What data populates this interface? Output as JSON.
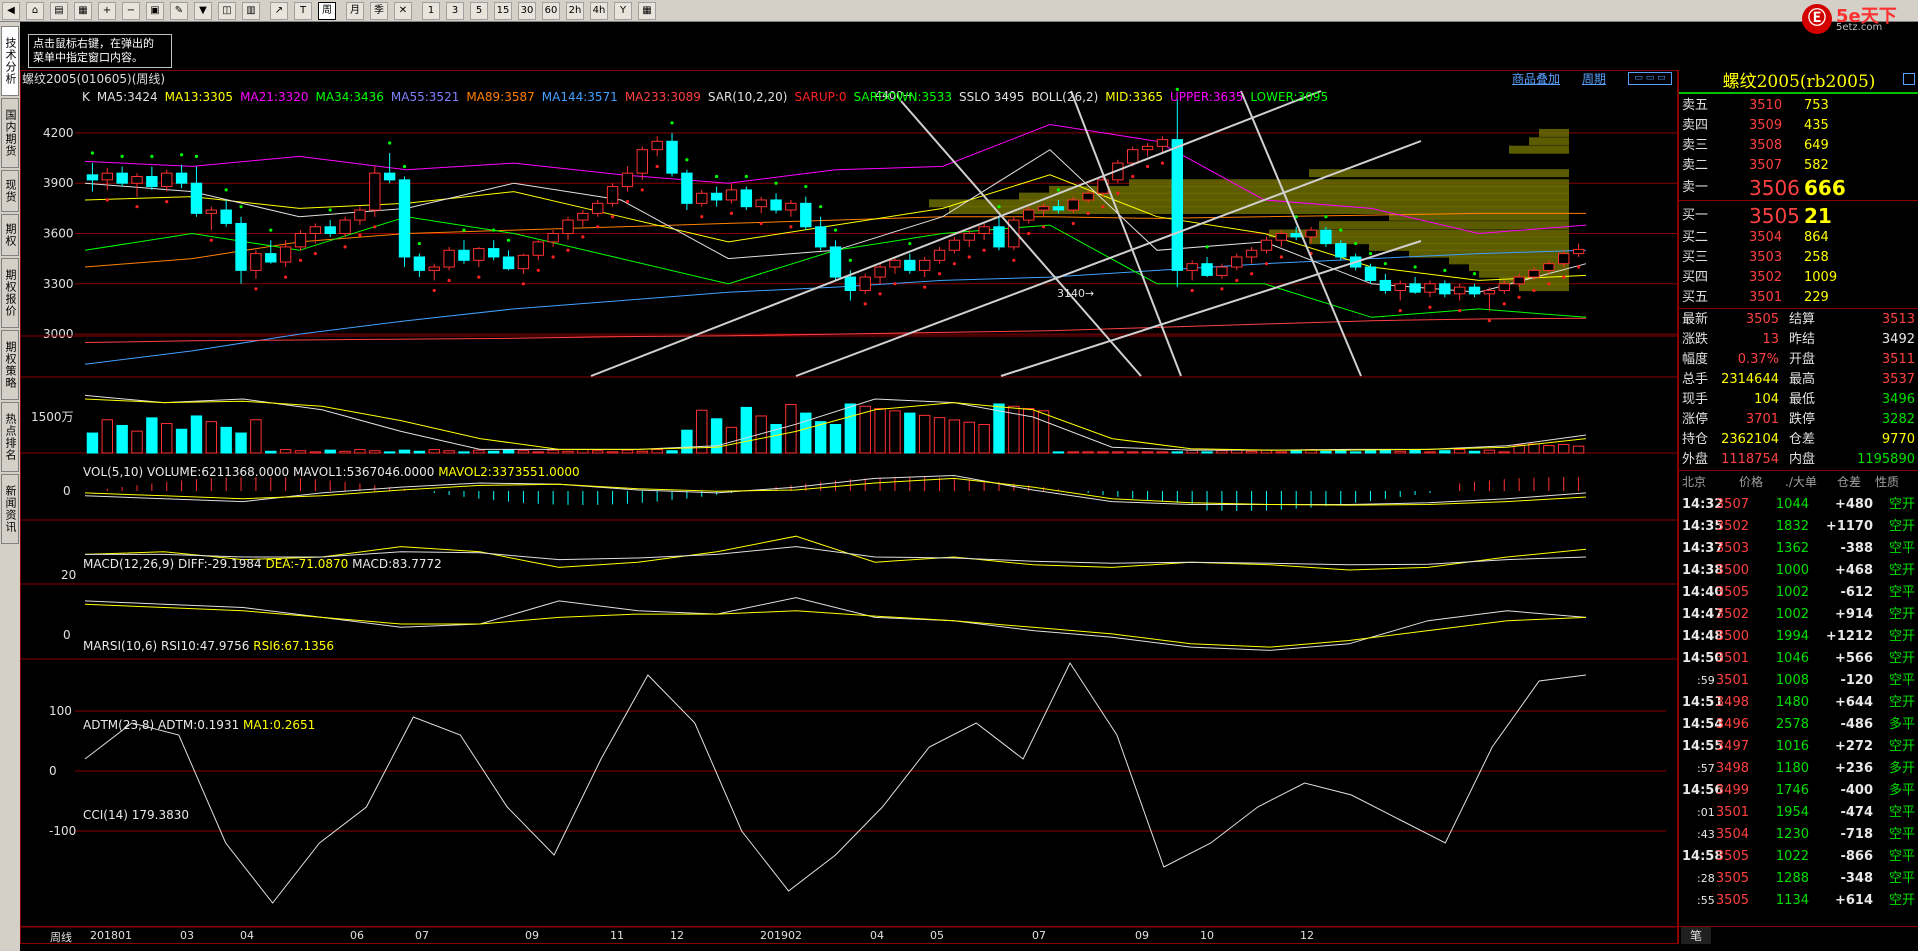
{
  "toolbar": {
    "buttons": [
      "back",
      "home",
      "folder",
      "doc",
      "zoom-in",
      "zoom-out",
      "window",
      "pen",
      "filter",
      "custom",
      "table",
      "trend",
      "tick",
      "weekly",
      "monthly",
      "season",
      "cross",
      "1",
      "3",
      "5",
      "15",
      "30",
      "60",
      "2h",
      "4h",
      "Y",
      "calc"
    ],
    "weekly_label": "周",
    "monthly_label": "月",
    "season_label": "季"
  },
  "logo": {
    "text": "5e天下",
    "sub": "5etz.com"
  },
  "hint": {
    "line1": "点击鼠标右键，在弹出的",
    "line2": "菜单中指定窗口内容。"
  },
  "left_tabs": [
    "技术分析",
    "国内期货",
    "现货",
    "期权",
    "期权报价",
    "期权策略",
    "热点排名",
    "新闻资讯"
  ],
  "title": {
    "left": "螺纹2005(010605)(周线)",
    "link1": "商品叠加",
    "link2": "周期"
  },
  "main_indicators": [
    {
      "t": "K",
      "c": "#e0e0e0"
    },
    {
      "t": "MA5:3424",
      "c": "#e0e0e0"
    },
    {
      "t": "MA13:3305",
      "c": "#ffff00"
    },
    {
      "t": "MA21:3320",
      "c": "#ff00ff"
    },
    {
      "t": "MA34:3436",
      "c": "#00ff00"
    },
    {
      "t": "MA55:3521",
      "c": "#8080ff"
    },
    {
      "t": "MA89:3587",
      "c": "#ff8000"
    },
    {
      "t": "MA144:3571",
      "c": "#40a0ff"
    },
    {
      "t": "MA233:3089",
      "c": "#ff4040"
    },
    {
      "t": "SAR(10,2,20)",
      "c": "#e0e0e0"
    },
    {
      "t": "SARUP:0",
      "c": "#ff2020"
    },
    {
      "t": "SARDOWN:3533",
      "c": "#00ff00"
    },
    {
      "t": "SSLO 3495",
      "c": "#e0e0e0"
    },
    {
      "t": "BOLL(26,2)",
      "c": "#e0e0e0"
    },
    {
      "t": "MID:3365",
      "c": "#ffff00"
    },
    {
      "t": "UPPER:3635",
      "c": "#ff00ff"
    },
    {
      "t": "LOWER:3095",
      "c": "#00ff00"
    }
  ],
  "price_axis": [
    "4200",
    "3900",
    "3600",
    "3300",
    "3000"
  ],
  "annot_high": "4400",
  "annot_low": "3140",
  "vol_label": {
    "a": "VOL(5,10)",
    "b": "VOLUME:6211368.0000",
    "c": "MAVOL1:5367046.0000",
    "d": "MAVOL2:3373551.0000"
  },
  "vol_axis": "1500万",
  "macd_label": {
    "a": "MACD(12,26,9)",
    "b": "DIFF:-29.1984",
    "c": "DEA:-71.0870",
    "d": "MACD:83.7772"
  },
  "macd_axis": "0",
  "marsi_label": {
    "a": "MARSI(10,6)",
    "b": "RSI10:47.9756",
    "c": "RSI6:67.1356"
  },
  "marsi_axis": "20",
  "adtm_label": {
    "a": "ADTM(23,8)",
    "b": "ADTM:0.1931",
    "c": "MA1:0.2651"
  },
  "adtm_axis": "0",
  "cci_label": {
    "a": "CCI(14)",
    "b": "179.3830"
  },
  "cci_axis": [
    "100",
    "0",
    "-100"
  ],
  "x_axis": [
    "201801",
    "03",
    "04",
    "06",
    "07",
    "09",
    "11",
    "12",
    "201902",
    "04",
    "05",
    "07",
    "09",
    "10",
    "12"
  ],
  "period_label": "周线",
  "quote": {
    "name": "螺纹2005(rb2005)",
    "asks": [
      {
        "l": "卖五",
        "p": "3510",
        "v": "753"
      },
      {
        "l": "卖四",
        "p": "3509",
        "v": "435"
      },
      {
        "l": "卖三",
        "p": "3508",
        "v": "649"
      },
      {
        "l": "卖二",
        "p": "3507",
        "v": "582"
      },
      {
        "l": "卖一",
        "p": "3506",
        "v": "666"
      }
    ],
    "bids": [
      {
        "l": "买一",
        "p": "3505",
        "v": "21"
      },
      {
        "l": "买二",
        "p": "3504",
        "v": "864"
      },
      {
        "l": "买三",
        "p": "3503",
        "v": "258"
      },
      {
        "l": "买四",
        "p": "3502",
        "v": "1009"
      },
      {
        "l": "买五",
        "p": "3501",
        "v": "229"
      }
    ],
    "stats": [
      {
        "l1": "最新",
        "v1": "3505",
        "l2": "结算",
        "v2": "3513"
      },
      {
        "l1": "涨跌",
        "v1": "13",
        "l2": "昨结",
        "v2": "3492"
      },
      {
        "l1": "幅度",
        "v1": "0.37%",
        "l2": "开盘",
        "v2": "3511"
      },
      {
        "l1": "总手",
        "v1": "2314644",
        "l2": "最高",
        "v2": "3537"
      },
      {
        "l1": "现手",
        "v1": "104",
        "l2": "最低",
        "v2": "3496"
      },
      {
        "l1": "涨停",
        "v1": "3701",
        "l2": "跌停",
        "v2": "3282"
      },
      {
        "l1": "持仓",
        "v1": "2362104",
        "l2": "仓差",
        "v2": "9770"
      },
      {
        "l1": "外盘",
        "v1": "1118754",
        "l2": "内盘",
        "v2": "1195890"
      }
    ],
    "tick_headers": [
      "北京",
      "价格",
      "./大单",
      "仓差",
      "性质"
    ],
    "ticks": [
      {
        "t": "14:32",
        "p": "3507",
        "v": "1044",
        "d": "+480",
        "n": "空开"
      },
      {
        "t": "14:35",
        "p": "3502",
        "v": "1832",
        "d": "+1170",
        "n": "空开"
      },
      {
        "t": "14:37",
        "p": "3503",
        "v": "1362",
        "d": "-388",
        "n": "空平"
      },
      {
        "t": "14:38",
        "p": "3500",
        "v": "1000",
        "d": "+468",
        "n": "空开"
      },
      {
        "t": "14:40",
        "p": "3505",
        "v": "1002",
        "d": "-612",
        "n": "空平"
      },
      {
        "t": "14:47",
        "p": "3502",
        "v": "1002",
        "d": "+914",
        "n": "空开"
      },
      {
        "t": "14:48",
        "p": "3500",
        "v": "1994",
        "d": "+1212",
        "n": "空开"
      },
      {
        "t": "14:50",
        "p": "3501",
        "v": "1046",
        "d": "+566",
        "n": "空开"
      },
      {
        "t": ":59",
        "p": "3501",
        "v": "1008",
        "d": "-120",
        "n": "空平"
      },
      {
        "t": "14:51",
        "p": "3498",
        "v": "1480",
        "d": "+644",
        "n": "空开"
      },
      {
        "t": "14:54",
        "p": "3496",
        "v": "2578",
        "d": "-486",
        "n": "多平"
      },
      {
        "t": "14:55",
        "p": "3497",
        "v": "1016",
        "d": "+272",
        "n": "空开"
      },
      {
        "t": ":57",
        "p": "3498",
        "v": "1180",
        "d": "+236",
        "n": "多开"
      },
      {
        "t": "14:56",
        "p": "3499",
        "v": "1746",
        "d": "-400",
        "n": "多平"
      },
      {
        "t": ":01",
        "p": "3501",
        "v": "1954",
        "d": "-474",
        "n": "空平"
      },
      {
        "t": ":43",
        "p": "3504",
        "v": "1230",
        "d": "-718",
        "n": "空平"
      },
      {
        "t": "14:58",
        "p": "3505",
        "v": "1022",
        "d": "-866",
        "n": "空平"
      },
      {
        "t": ":28",
        "p": "3505",
        "v": "1288",
        "d": "-348",
        "n": "空平"
      },
      {
        "t": ":55",
        "p": "3505",
        "v": "1134",
        "d": "+614",
        "n": "空开"
      }
    ],
    "footer_tab": "笔"
  },
  "chart_data": {
    "type": "candlestick",
    "ohlc": [
      [
        3950,
        4020,
        3850,
        3920
      ],
      [
        3920,
        3990,
        3860,
        3960
      ],
      [
        3960,
        4000,
        3880,
        3900
      ],
      [
        3900,
        3960,
        3820,
        3940
      ],
      [
        3940,
        4000,
        3860,
        3880
      ],
      [
        3880,
        3980,
        3850,
        3960
      ],
      [
        3960,
        4010,
        3870,
        3900
      ],
      [
        3900,
        4000,
        3700,
        3720
      ],
      [
        3720,
        3760,
        3620,
        3740
      ],
      [
        3740,
        3800,
        3640,
        3660
      ],
      [
        3660,
        3700,
        3300,
        3380
      ],
      [
        3380,
        3500,
        3330,
        3480
      ],
      [
        3480,
        3560,
        3420,
        3430
      ],
      [
        3430,
        3560,
        3400,
        3520
      ],
      [
        3520,
        3620,
        3500,
        3600
      ],
      [
        3600,
        3660,
        3540,
        3640
      ],
      [
        3640,
        3680,
        3580,
        3600
      ],
      [
        3600,
        3700,
        3580,
        3680
      ],
      [
        3680,
        3760,
        3650,
        3740
      ],
      [
        3740,
        4000,
        3700,
        3960
      ],
      [
        3960,
        4080,
        3900,
        3920
      ],
      [
        3920,
        3940,
        3400,
        3460
      ],
      [
        3460,
        3480,
        3340,
        3380
      ],
      [
        3380,
        3420,
        3320,
        3400
      ],
      [
        3400,
        3520,
        3380,
        3500
      ],
      [
        3500,
        3560,
        3420,
        3440
      ],
      [
        3440,
        3520,
        3400,
        3510
      ],
      [
        3510,
        3560,
        3440,
        3460
      ],
      [
        3460,
        3500,
        3380,
        3390
      ],
      [
        3390,
        3480,
        3360,
        3470
      ],
      [
        3470,
        3560,
        3440,
        3550
      ],
      [
        3550,
        3620,
        3520,
        3600
      ],
      [
        3600,
        3700,
        3560,
        3680
      ],
      [
        3680,
        3740,
        3640,
        3720
      ],
      [
        3720,
        3800,
        3700,
        3780
      ],
      [
        3780,
        3900,
        3760,
        3880
      ],
      [
        3880,
        4000,
        3850,
        3960
      ],
      [
        3960,
        4120,
        3920,
        4100
      ],
      [
        4100,
        4180,
        4060,
        4150
      ],
      [
        4150,
        4200,
        3940,
        3960
      ],
      [
        3960,
        3980,
        3740,
        3780
      ],
      [
        3780,
        3860,
        3760,
        3840
      ],
      [
        3840,
        3880,
        3760,
        3800
      ],
      [
        3800,
        3900,
        3780,
        3860
      ],
      [
        3860,
        3880,
        3740,
        3760
      ],
      [
        3760,
        3820,
        3720,
        3800
      ],
      [
        3800,
        3840,
        3720,
        3740
      ],
      [
        3740,
        3800,
        3700,
        3780
      ],
      [
        3780,
        3820,
        3620,
        3640
      ],
      [
        3640,
        3700,
        3500,
        3520
      ],
      [
        3520,
        3560,
        3320,
        3340
      ],
      [
        3340,
        3380,
        3200,
        3260
      ],
      [
        3260,
        3360,
        3240,
        3340
      ],
      [
        3340,
        3420,
        3300,
        3400
      ],
      [
        3400,
        3460,
        3360,
        3440
      ],
      [
        3440,
        3480,
        3360,
        3380
      ],
      [
        3380,
        3460,
        3340,
        3440
      ],
      [
        3440,
        3520,
        3420,
        3500
      ],
      [
        3500,
        3580,
        3480,
        3560
      ],
      [
        3560,
        3620,
        3520,
        3600
      ],
      [
        3600,
        3660,
        3560,
        3640
      ],
      [
        3640,
        3700,
        3500,
        3520
      ],
      [
        3520,
        3700,
        3500,
        3680
      ],
      [
        3680,
        3760,
        3660,
        3740
      ],
      [
        3740,
        3780,
        3700,
        3760
      ],
      [
        3760,
        3800,
        3720,
        3740
      ],
      [
        3740,
        3820,
        3720,
        3800
      ],
      [
        3800,
        3860,
        3780,
        3840
      ],
      [
        3840,
        3940,
        3820,
        3920
      ],
      [
        3920,
        4040,
        3900,
        4020
      ],
      [
        4020,
        4120,
        4000,
        4100
      ],
      [
        4100,
        4140,
        4060,
        4120
      ],
      [
        4120,
        4180,
        4080,
        4160
      ],
      [
        4160,
        4400,
        3280,
        3380
      ],
      [
        3380,
        3440,
        3320,
        3420
      ],
      [
        3420,
        3460,
        3340,
        3350
      ],
      [
        3350,
        3420,
        3330,
        3400
      ],
      [
        3400,
        3480,
        3380,
        3460
      ],
      [
        3460,
        3520,
        3420,
        3500
      ],
      [
        3500,
        3580,
        3480,
        3560
      ],
      [
        3560,
        3620,
        3520,
        3600
      ],
      [
        3600,
        3640,
        3560,
        3580
      ],
      [
        3580,
        3640,
        3540,
        3620
      ],
      [
        3620,
        3640,
        3520,
        3540
      ],
      [
        3540,
        3560,
        3440,
        3460
      ],
      [
        3460,
        3480,
        3380,
        3400
      ],
      [
        3400,
        3420,
        3300,
        3320
      ],
      [
        3320,
        3360,
        3240,
        3260
      ],
      [
        3260,
        3320,
        3200,
        3300
      ],
      [
        3300,
        3340,
        3240,
        3250
      ],
      [
        3250,
        3320,
        3220,
        3300
      ],
      [
        3300,
        3320,
        3220,
        3240
      ],
      [
        3240,
        3300,
        3200,
        3280
      ],
      [
        3280,
        3300,
        3220,
        3240
      ],
      [
        3240,
        3280,
        3140,
        3260
      ],
      [
        3260,
        3320,
        3240,
        3300
      ],
      [
        3300,
        3360,
        3280,
        3340
      ],
      [
        3340,
        3400,
        3320,
        3380
      ],
      [
        3380,
        3440,
        3360,
        3420
      ],
      [
        3420,
        3500,
        3400,
        3480
      ],
      [
        3480,
        3540,
        3460,
        3505
      ]
    ],
    "ylim": [
      2750,
      4450
    ]
  }
}
